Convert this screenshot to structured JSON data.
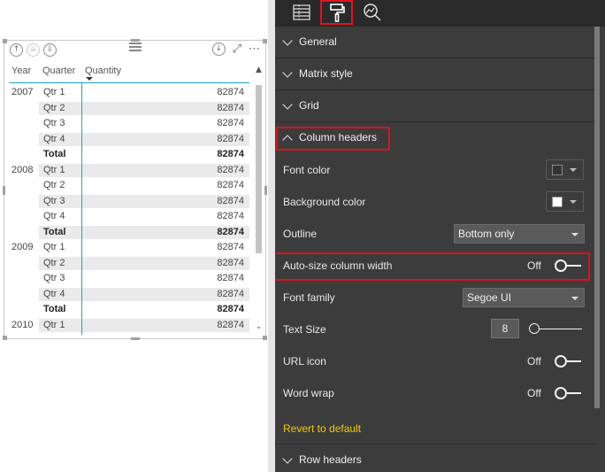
{
  "visual": {
    "columns": {
      "year": "Year",
      "quarter": "Quarter",
      "quantity": "Quantity"
    },
    "rows": [
      {
        "year": "2007",
        "quarter": "Qtr 1",
        "value": "82874",
        "total": false
      },
      {
        "year": "",
        "quarter": "Qtr 2",
        "value": "82874",
        "total": false
      },
      {
        "year": "",
        "quarter": "Qtr 3",
        "value": "82874",
        "total": false
      },
      {
        "year": "",
        "quarter": "Qtr 4",
        "value": "82874",
        "total": false
      },
      {
        "year": "",
        "quarter": "Total",
        "value": "82874",
        "total": true
      },
      {
        "year": "2008",
        "quarter": "Qtr 1",
        "value": "82874",
        "total": false
      },
      {
        "year": "",
        "quarter": "Qtr 2",
        "value": "82874",
        "total": false
      },
      {
        "year": "",
        "quarter": "Qtr 3",
        "value": "82874",
        "total": false
      },
      {
        "year": "",
        "quarter": "Qtr 4",
        "value": "82874",
        "total": false
      },
      {
        "year": "",
        "quarter": "Total",
        "value": "82874",
        "total": true
      },
      {
        "year": "2009",
        "quarter": "Qtr 1",
        "value": "82874",
        "total": false
      },
      {
        "year": "",
        "quarter": "Qtr 2",
        "value": "82874",
        "total": false
      },
      {
        "year": "",
        "quarter": "Qtr 3",
        "value": "82874",
        "total": false
      },
      {
        "year": "",
        "quarter": "Qtr 4",
        "value": "82874",
        "total": false
      },
      {
        "year": "",
        "quarter": "Total",
        "value": "82874",
        "total": true
      },
      {
        "year": "2010",
        "quarter": "Qtr 1",
        "value": "82874",
        "total": false
      }
    ]
  },
  "pane": {
    "sections": {
      "general": "General",
      "matrix_style": "Matrix style",
      "grid": "Grid",
      "column_headers": "Column headers",
      "row_headers": "Row headers"
    },
    "props": {
      "font_color": {
        "label": "Font color",
        "swatch": "#333333"
      },
      "background_color": {
        "label": "Background color",
        "swatch": "#ffffff"
      },
      "outline": {
        "label": "Outline",
        "value": "Bottom only"
      },
      "auto_size": {
        "label": "Auto-size column width",
        "state": "Off"
      },
      "font_family": {
        "label": "Font family",
        "value": "Segoe UI"
      },
      "text_size": {
        "label": "Text Size",
        "value": "8"
      },
      "url_icon": {
        "label": "URL icon",
        "state": "Off"
      },
      "word_wrap": {
        "label": "Word wrap",
        "state": "Off"
      }
    },
    "revert": "Revert to default"
  },
  "colors": {
    "highlight": "#d7141e",
    "accent": "#f2c811",
    "matrix_line": "#1ea1c9"
  }
}
